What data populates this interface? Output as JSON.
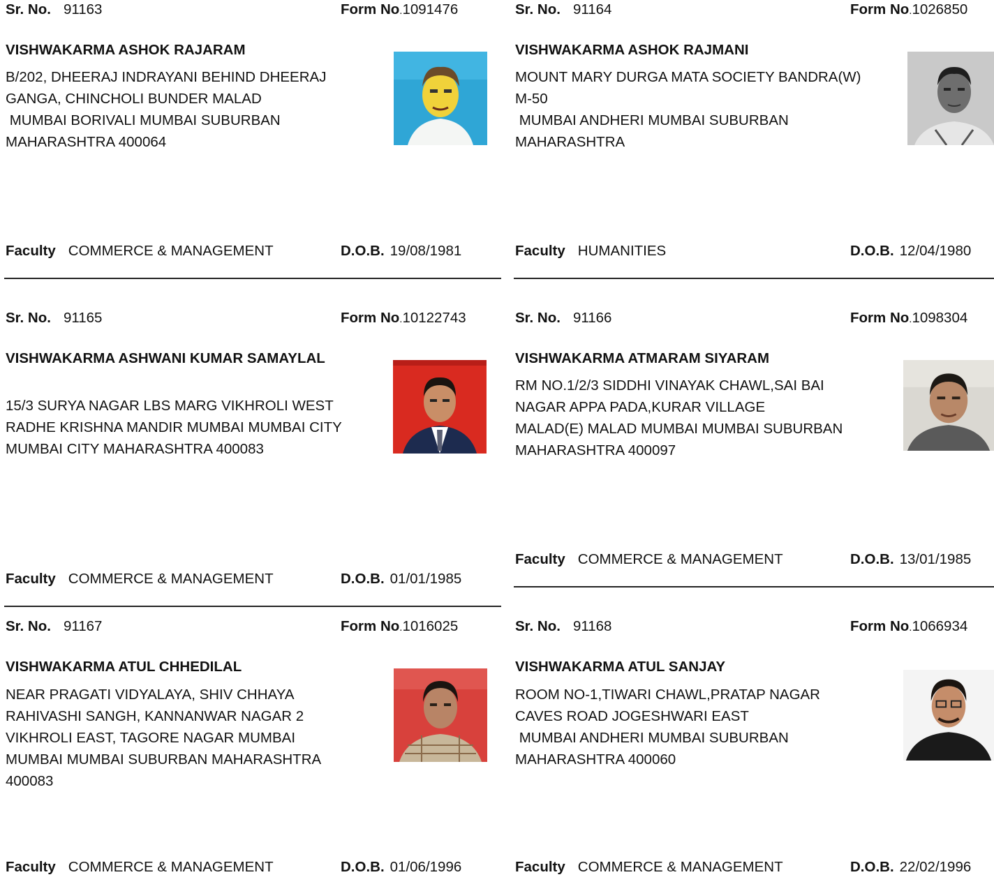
{
  "labels": {
    "sr": "Sr. No.",
    "form": "Form No",
    "faculty": "Faculty",
    "dob": "D.O.B."
  },
  "records": [
    {
      "sr_no": "91163",
      "form_no": "1091476",
      "name": "VISHWAKARMA ASHOK RAJARAM",
      "address": [
        "B/202, DHEERAJ INDRAYANI BEHIND DHEERAJ",
        "GANGA, CHINCHOLI BUNDER MALAD",
        " MUMBAI BORIVALI MUMBAI SUBURBAN",
        "MAHARASHTRA 400064"
      ],
      "faculty": "COMMERCE & MANAGEMENT",
      "dob": "19/08/1981"
    },
    {
      "sr_no": "91164",
      "form_no": "1026850",
      "name": "VISHWAKARMA ASHOK RAJMANI",
      "address": [
        "MOUNT MARY DURGA MATA SOCIETY BANDRA(W)",
        "M-50",
        " MUMBAI ANDHERI MUMBAI SUBURBAN",
        "MAHARASHTRA"
      ],
      "faculty": "HUMANITIES",
      "dob": "12/04/1980"
    },
    {
      "sr_no": "91165",
      "form_no": "10122743",
      "name": "VISHWAKARMA ASHWANI KUMAR SAMAYLAL",
      "address": [
        "",
        "15/3 SURYA NAGAR LBS MARG VIKHROLI WEST",
        "RADHE KRISHNA MANDIR MUMBAI MUMBAI CITY",
        "MUMBAI CITY MAHARASHTRA 400083"
      ],
      "faculty": "COMMERCE & MANAGEMENT",
      "dob": "01/01/1985"
    },
    {
      "sr_no": "91166",
      "form_no": "1098304",
      "name": "VISHWAKARMA ATMARAM SIYARAM",
      "address": [
        "RM NO.1/2/3 SIDDHI VINAYAK CHAWL,SAI BAI",
        "NAGAR APPA PADA,KURAR VILLAGE",
        "MALAD(E) MALAD MUMBAI MUMBAI SUBURBAN",
        "MAHARASHTRA 400097"
      ],
      "faculty": "COMMERCE & MANAGEMENT",
      "dob": "13/01/1985"
    },
    {
      "sr_no": "91167",
      "form_no": "1016025",
      "name": "VISHWAKARMA ATUL CHHEDILAL",
      "address": [
        "NEAR PRAGATI VIDYALAYA, SHIV CHHAYA",
        "RAHIVASHI SANGH, KANNANWAR NAGAR 2",
        "VIKHROLI EAST, TAGORE NAGAR MUMBAI",
        "MUMBAI MUMBAI SUBURBAN MAHARASHTRA",
        "400083"
      ],
      "faculty": "COMMERCE & MANAGEMENT",
      "dob": "01/06/1996"
    },
    {
      "sr_no": "91168",
      "form_no": "1066934",
      "name": "VISHWAKARMA ATUL SANJAY",
      "address": [
        "ROOM NO-1,TIWARI CHAWL,PRATAP NAGAR",
        "CAVES ROAD JOGESHWARI EAST",
        " MUMBAI ANDHERI MUMBAI SUBURBAN",
        "MAHARASHTRA 400060"
      ],
      "faculty": "COMMERCE & MANAGEMENT",
      "dob": "22/02/1996"
    }
  ]
}
